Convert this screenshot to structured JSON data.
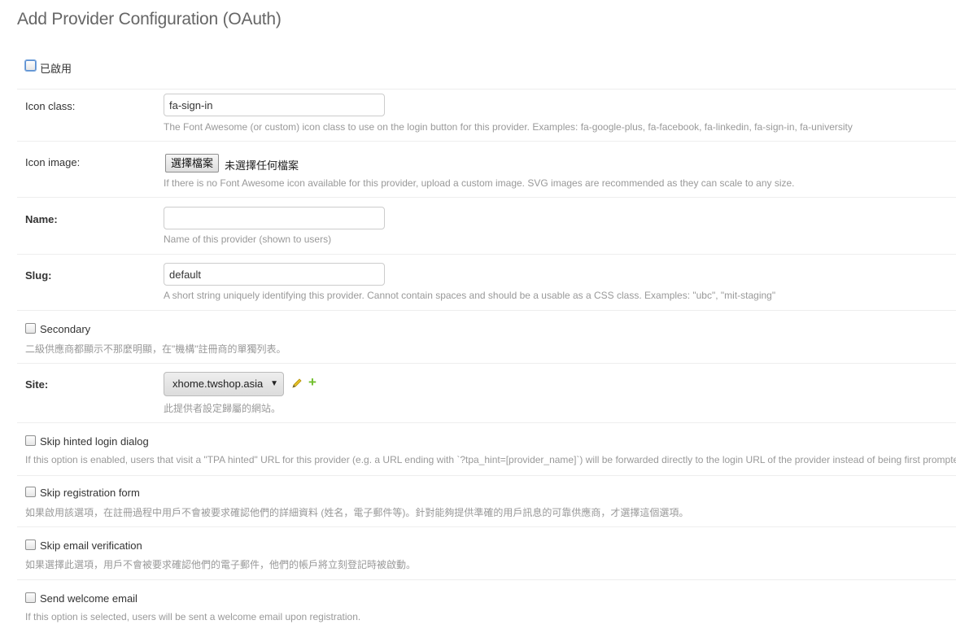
{
  "page": {
    "title": "Add Provider Configuration (OAuth)"
  },
  "enabled": {
    "label": "已啟用"
  },
  "icon_class": {
    "label": "Icon class:",
    "value": "fa-sign-in",
    "help": "The Font Awesome (or custom) icon class to use on the login button for this provider. Examples: fa-google-plus, fa-facebook, fa-linkedin, fa-sign-in, fa-university"
  },
  "icon_image": {
    "label": "Icon image:",
    "button": "選擇檔案",
    "status": "未選擇任何檔案",
    "help": "If there is no Font Awesome icon available for this provider, upload a custom image. SVG images are recommended as they can scale to any size."
  },
  "name": {
    "label": "Name:",
    "value": "",
    "help": "Name of this provider (shown to users)"
  },
  "slug": {
    "label": "Slug:",
    "value": "default",
    "help": "A short string uniquely identifying this provider. Cannot contain spaces and should be a usable as a CSS class. Examples: \"ubc\", \"mit-staging\""
  },
  "secondary": {
    "label": "Secondary",
    "help": "二級供應商都顯示不那麼明顯，在\"機構\"註冊商的單獨列表。"
  },
  "site": {
    "label": "Site:",
    "value": "xhome.twshop.asia",
    "help": "此提供者設定歸屬的網站。"
  },
  "skip_hinted": {
    "label": "Skip hinted login dialog",
    "help": "If this option is enabled, users that visit a \"TPA hinted\" URL for this provider (e.g. a URL ending with `?tpa_hint=[provider_name]`) will be forwarded directly to the login URL of the provider instead of being first prompted"
  },
  "skip_registration": {
    "label": "Skip registration form",
    "help": "如果啟用該選項，在註冊過程中用戶不會被要求確認他們的詳細資料 (姓名，電子郵件等)。針對能夠提供準確的用戶訊息的可靠供應商，才選擇這個選項。"
  },
  "skip_email": {
    "label": "Skip email verification",
    "help": "如果選擇此選項，用戶不會被要求確認他們的電子郵件，他們的帳戶將立刻登記時被啟動。"
  },
  "send_welcome": {
    "label": "Send welcome email",
    "help": "If this option is selected, users will be sent a welcome email upon registration."
  }
}
